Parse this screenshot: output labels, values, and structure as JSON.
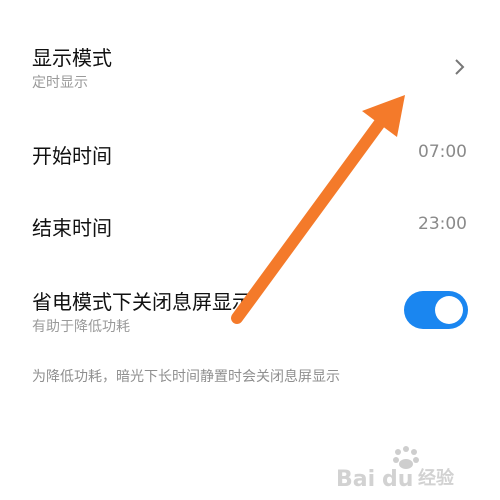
{
  "display_mode": {
    "title": "显示模式",
    "subtitle": "定时显示",
    "icon": "chevron-right-icon"
  },
  "start_time": {
    "title": "开始时间",
    "value": "07:00"
  },
  "end_time": {
    "title": "结束时间",
    "value": "23:00"
  },
  "power_saving": {
    "title": "省电模式下关闭息屏显示",
    "subtitle": "有助于降低功耗",
    "toggle_on": true
  },
  "note": "为降低功耗，暗光下长时间静置时会关闭息屏显示",
  "colors": {
    "toggle_on": "#1a86f0",
    "annotation_arrow": "#f47a2a"
  },
  "watermark": "Baidu经验"
}
